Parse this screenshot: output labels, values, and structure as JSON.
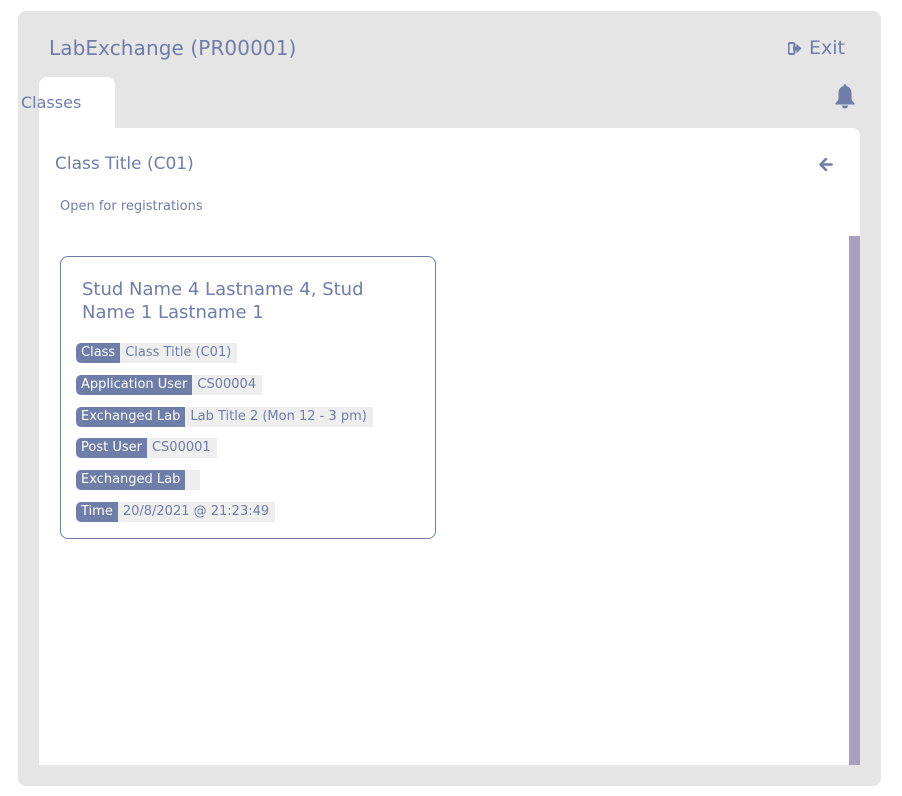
{
  "app": {
    "title": "LabExchange (PR00001)",
    "exit_label": "Exit"
  },
  "tabs": [
    {
      "label": "Classes",
      "active": true
    }
  ],
  "header_icons": {
    "notifications": "bell-icon",
    "exit": "sign-out-icon",
    "back": "arrow-left-icon"
  },
  "class_view": {
    "title": "Class Title (C01)",
    "status": "Open for registrations"
  },
  "exchange_card": {
    "names": "Stud Name 4 Lastname 4, Stud Name 1 Lastname 1",
    "fields": [
      {
        "label": "Class",
        "value": "Class Title (C01)"
      },
      {
        "label": "Application User",
        "value": "CS00004"
      },
      {
        "label": "Exchanged Lab",
        "value": "Lab Title 2 (Mon 12 - 3 pm)"
      },
      {
        "label": "Post User",
        "value": "CS00001"
      },
      {
        "label": "Exchanged Lab",
        "value": ""
      },
      {
        "label": "Time",
        "value": "20/8/2021 @ 21:23:49"
      }
    ]
  },
  "colors": {
    "accent": "#6f7da9",
    "frame": "#e5e5e5",
    "scrollbar": "#a7a0bf",
    "value_bg": "#eeeeee"
  }
}
